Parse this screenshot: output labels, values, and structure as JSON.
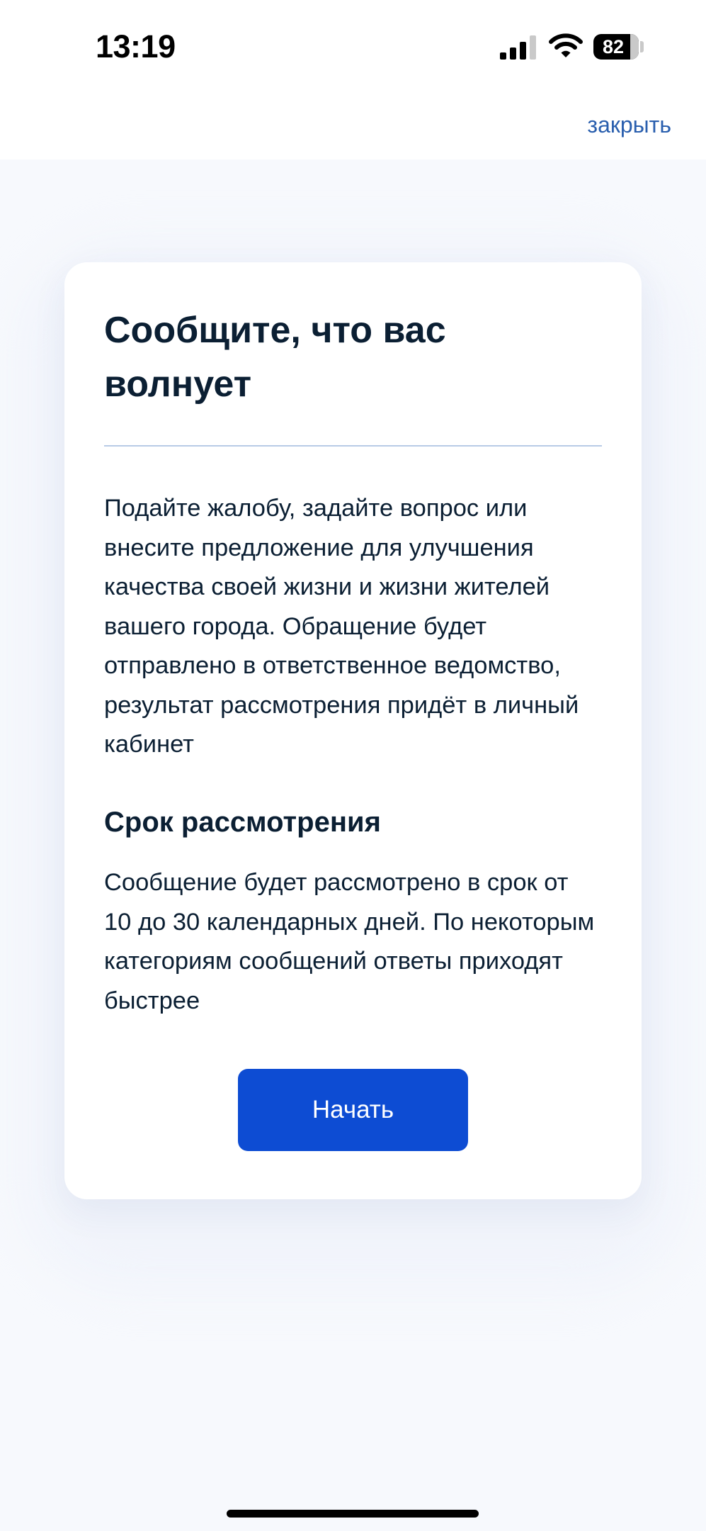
{
  "status_bar": {
    "time": "13:19",
    "battery_level": "82",
    "icons": [
      "cellular-signal-icon",
      "wifi-icon",
      "battery-icon"
    ]
  },
  "header": {
    "close_label": "закрыть"
  },
  "card": {
    "title": "Сообщите, что вас волнует",
    "intro": "Подайте жалобу, задайте вопрос или внесите предложение для улучшения качества своей жизни и жизни жителей вашего города. Обращение будет отправлено в ответственное ведомство, результат рассмотрения придёт в личный кабинет",
    "deadline_title": "Срок рассмотрения",
    "deadline_text": "Сообщение будет рассмотрено в срок от 10 до 30 календарных дней. По некоторым категориям сообщений ответы приходят быстрее",
    "start_label": "Начать"
  },
  "colors": {
    "accent": "#0d4cd3",
    "link": "#2a5fae",
    "text": "#0b1f33",
    "background": "#f7f9fd",
    "card": "#ffffff",
    "divider": "#b8cbe6"
  }
}
